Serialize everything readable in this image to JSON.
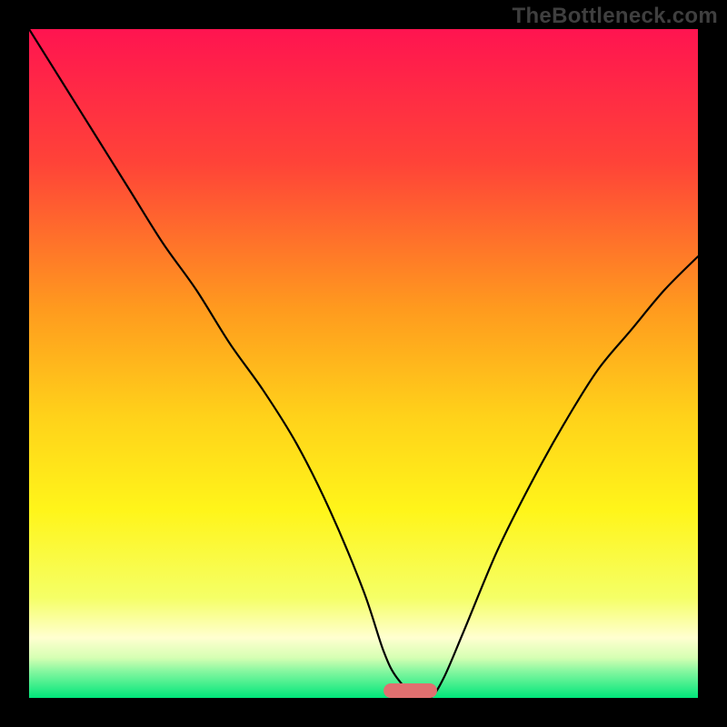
{
  "watermark": "TheBottleneck.com",
  "chart_data": {
    "type": "line",
    "title": "",
    "xlabel": "",
    "ylabel": "",
    "xlim": [
      0,
      100
    ],
    "ylim": [
      0,
      100
    ],
    "background_gradient": {
      "stops": [
        {
          "offset": 0,
          "color": "#ff1450"
        },
        {
          "offset": 20,
          "color": "#ff4338"
        },
        {
          "offset": 42,
          "color": "#ff9b1e"
        },
        {
          "offset": 58,
          "color": "#ffd21a"
        },
        {
          "offset": 72,
          "color": "#fff51a"
        },
        {
          "offset": 85,
          "color": "#f5ff66"
        },
        {
          "offset": 91,
          "color": "#ffffd0"
        },
        {
          "offset": 94,
          "color": "#d6ffb3"
        },
        {
          "offset": 96,
          "color": "#86f7a0"
        },
        {
          "offset": 100,
          "color": "#00e67a"
        }
      ]
    },
    "series": [
      {
        "name": "bottleneck-curve",
        "color": "#000000",
        "x": [
          0,
          5,
          10,
          15,
          20,
          25,
          30,
          35,
          40,
          45,
          50,
          53,
          55,
          58,
          60,
          62,
          65,
          70,
          75,
          80,
          85,
          90,
          95,
          100
        ],
        "y": [
          100,
          92,
          84,
          76,
          68,
          61,
          53,
          46,
          38,
          28,
          16,
          7,
          3,
          0,
          0,
          3,
          10,
          22,
          32,
          41,
          49,
          55,
          61,
          66
        ]
      }
    ],
    "marker": {
      "name": "optimal-range",
      "shape": "pill",
      "color": "#e07070",
      "x_center": 57,
      "width_pct": 8,
      "y": 0
    }
  }
}
